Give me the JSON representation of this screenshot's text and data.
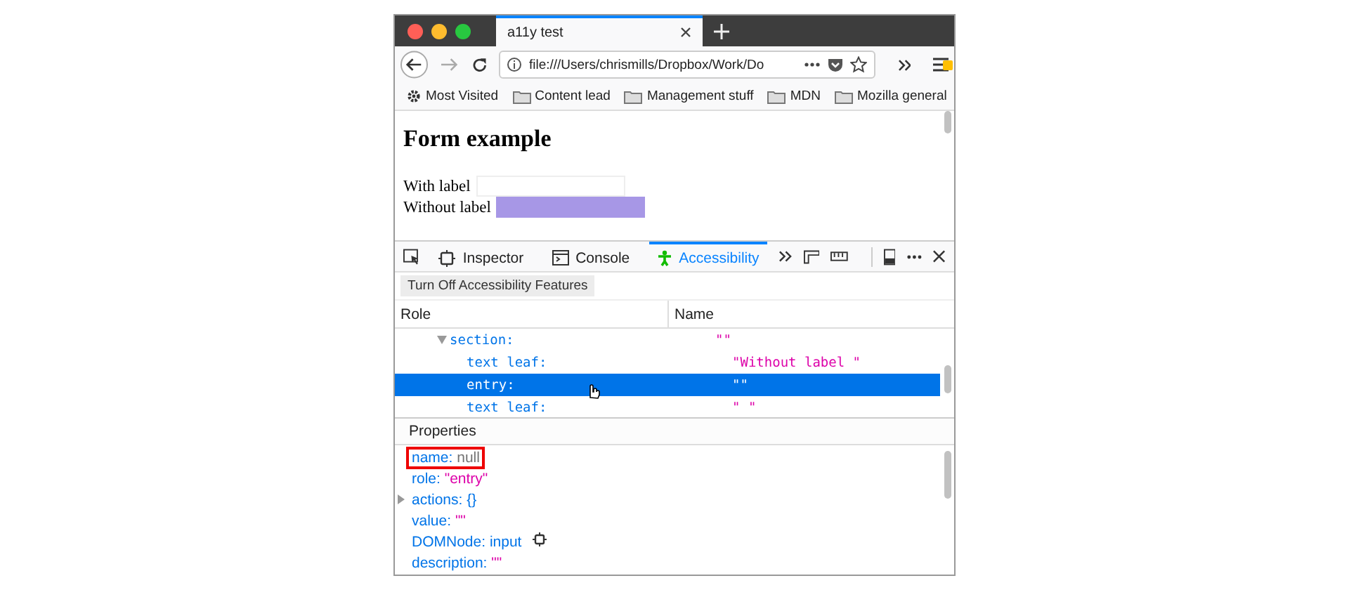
{
  "browser_tabs": [
    {
      "title": "a11y test",
      "selected": true
    }
  ],
  "url": "file:///Users/chrismills/Dropbox/Work/Do",
  "bookmarks": [
    {
      "label": "Most Visited",
      "kind": "gear"
    },
    {
      "label": "Content lead",
      "kind": "folder"
    },
    {
      "label": "Management stuff",
      "kind": "folder"
    },
    {
      "label": "MDN",
      "kind": "folder"
    },
    {
      "label": "Mozilla general",
      "kind": "folder"
    }
  ],
  "page": {
    "heading": "Form example",
    "fields": [
      {
        "label": "With label",
        "highlighted": false
      },
      {
        "label": "Without label",
        "highlighted": true
      }
    ]
  },
  "devtools_tabs": [
    {
      "label": "Inspector",
      "kind": "inspector",
      "selected": false
    },
    {
      "label": "Console",
      "kind": "console",
      "selected": false
    },
    {
      "label": "Accessibility",
      "kind": "accessibility",
      "selected": true
    }
  ],
  "toggle_button": "Turn Off Accessibility Features",
  "tree": {
    "columns": [
      "Role",
      "Name"
    ],
    "rows": [
      {
        "role": "section:",
        "name": "\"\"",
        "selected": false,
        "expanded": true,
        "children": [
          {
            "role": "text leaf:",
            "name": "\"Without label \"",
            "selected": false
          },
          {
            "role": "entry:",
            "name": "\"\"",
            "selected": true
          },
          {
            "role": "text leaf:",
            "name": "\" \"",
            "selected": false
          }
        ]
      }
    ]
  },
  "properties": {
    "title": "Properties",
    "items": [
      {
        "key": "name:",
        "value": "null",
        "kind": "null",
        "outlined": true
      },
      {
        "key": "role:",
        "value": "\"entry\"",
        "kind": "string",
        "outlined": false
      },
      {
        "key": "actions:",
        "value": "{}",
        "kind": "object",
        "outlined": false
      },
      {
        "key": "value:",
        "value": "\"\"",
        "kind": "string",
        "outlined": false
      },
      {
        "key": "DOMNode:",
        "value": "input",
        "kind": "node",
        "outlined": false
      },
      {
        "key": "description:",
        "value": "\"\"",
        "kind": "string",
        "outlined": false
      }
    ]
  }
}
